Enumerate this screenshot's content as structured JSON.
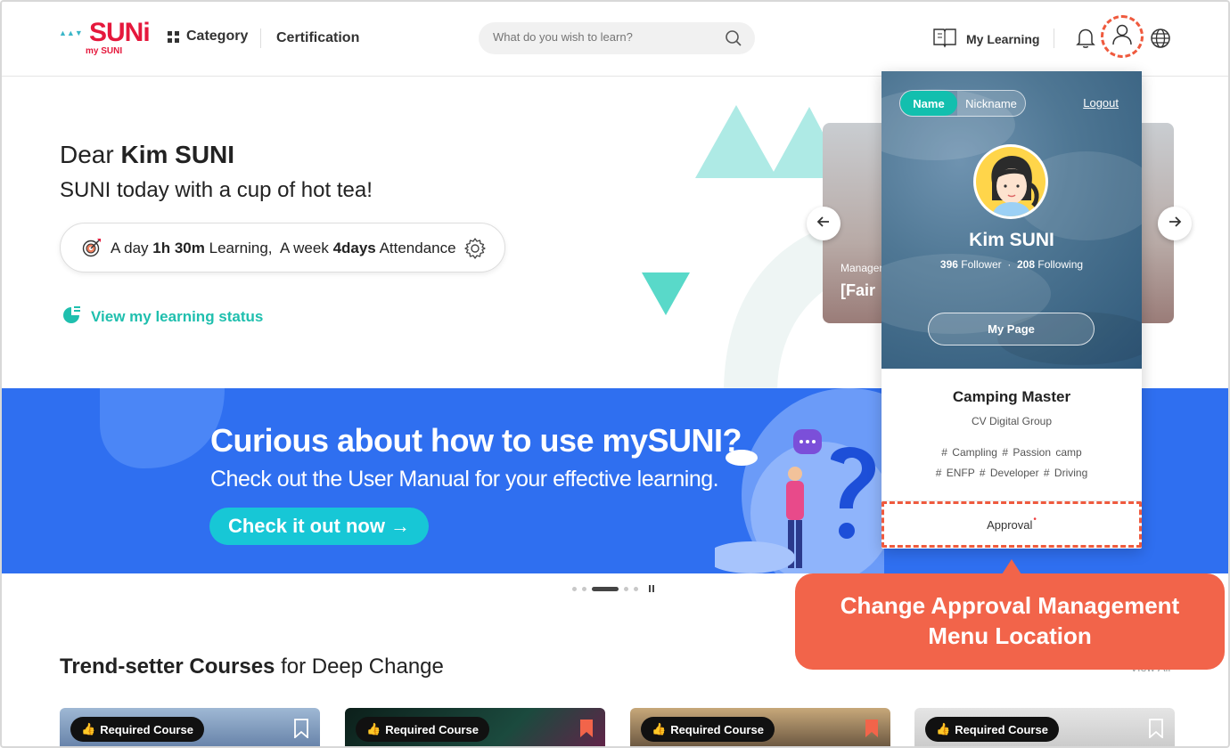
{
  "header": {
    "logo_text": "SUNi",
    "logo_sub": "my SUNI",
    "nav": {
      "category": "Category",
      "certification": "Certification"
    },
    "search_placeholder": "What do you wish to learn?",
    "my_learning": "My Learning"
  },
  "hero": {
    "greeting_prefix": "Dear",
    "user_name": "Kim SUNI",
    "greeting_sub": "SUNI today with a cup of hot tea!",
    "stats": {
      "day_label": "A day",
      "day_value": "1h 30m",
      "day_unit": "Learning,",
      "week_label": "A week",
      "week_value": "4days",
      "week_unit": "Attendance"
    },
    "view_status": "View my learning status"
  },
  "carousel_card": {
    "meta": "Manager",
    "title": "[Fair"
  },
  "banner": {
    "headline": "Curious about how to use mySUNI?",
    "subline": "Check out the User Manual for your effective learning.",
    "cta": "Check it out now →"
  },
  "profile_popup": {
    "toggle_name": "Name",
    "toggle_nickname": "Nickname",
    "logout": "Logout",
    "name": "Kim SUNI",
    "followers_count": "396",
    "followers_label": "Follower",
    "following_count": "208",
    "following_label": "Following",
    "my_page": "My Page",
    "club": "Camping Master",
    "org": "CV Digital Group",
    "tags_line1": "# Campling # Passion camp",
    "tags_line2": "# ENFP # Developer # Driving",
    "approval": "Approval",
    "approval_dot": "•"
  },
  "callout": {
    "line1": "Change Approval Management",
    "line2": "Menu Location"
  },
  "trend": {
    "title_bold": "Trend-setter Courses",
    "title_rest": "for Deep Change",
    "view_all": "View All"
  },
  "courses": [
    {
      "badge": "Required Course",
      "bookmarked": false,
      "bg": "#6f8fb3"
    },
    {
      "badge": "Required Course",
      "bookmarked": true,
      "bg": "#1a2e2a"
    },
    {
      "badge": "Required Course",
      "bookmarked": true,
      "bg": "#5a4a3c"
    },
    {
      "badge": "Required Course",
      "bookmarked": false,
      "bg": "#cfcfcf"
    }
  ],
  "colors": {
    "accent_teal": "#1fbfae",
    "banner_blue": "#2f6ff0",
    "highlight_orange": "#f2644a",
    "brand_red": "#e5183c"
  }
}
